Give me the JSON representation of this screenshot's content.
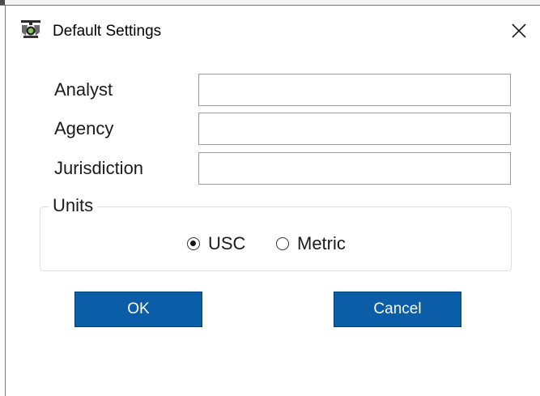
{
  "window": {
    "title": "Default Settings",
    "app_icon": "traffic-signal-app-icon",
    "close_icon": "close-icon",
    "accent_color": "#0a5da6"
  },
  "form": {
    "analyst": {
      "label": "Analyst",
      "value": ""
    },
    "agency": {
      "label": "Agency",
      "value": ""
    },
    "jurisdiction": {
      "label": "Jurisdiction",
      "value": ""
    }
  },
  "units": {
    "legend": "Units",
    "options": [
      {
        "label": "USC",
        "selected": true
      },
      {
        "label": "Metric",
        "selected": false
      }
    ]
  },
  "buttons": {
    "ok": "OK",
    "cancel": "Cancel"
  }
}
